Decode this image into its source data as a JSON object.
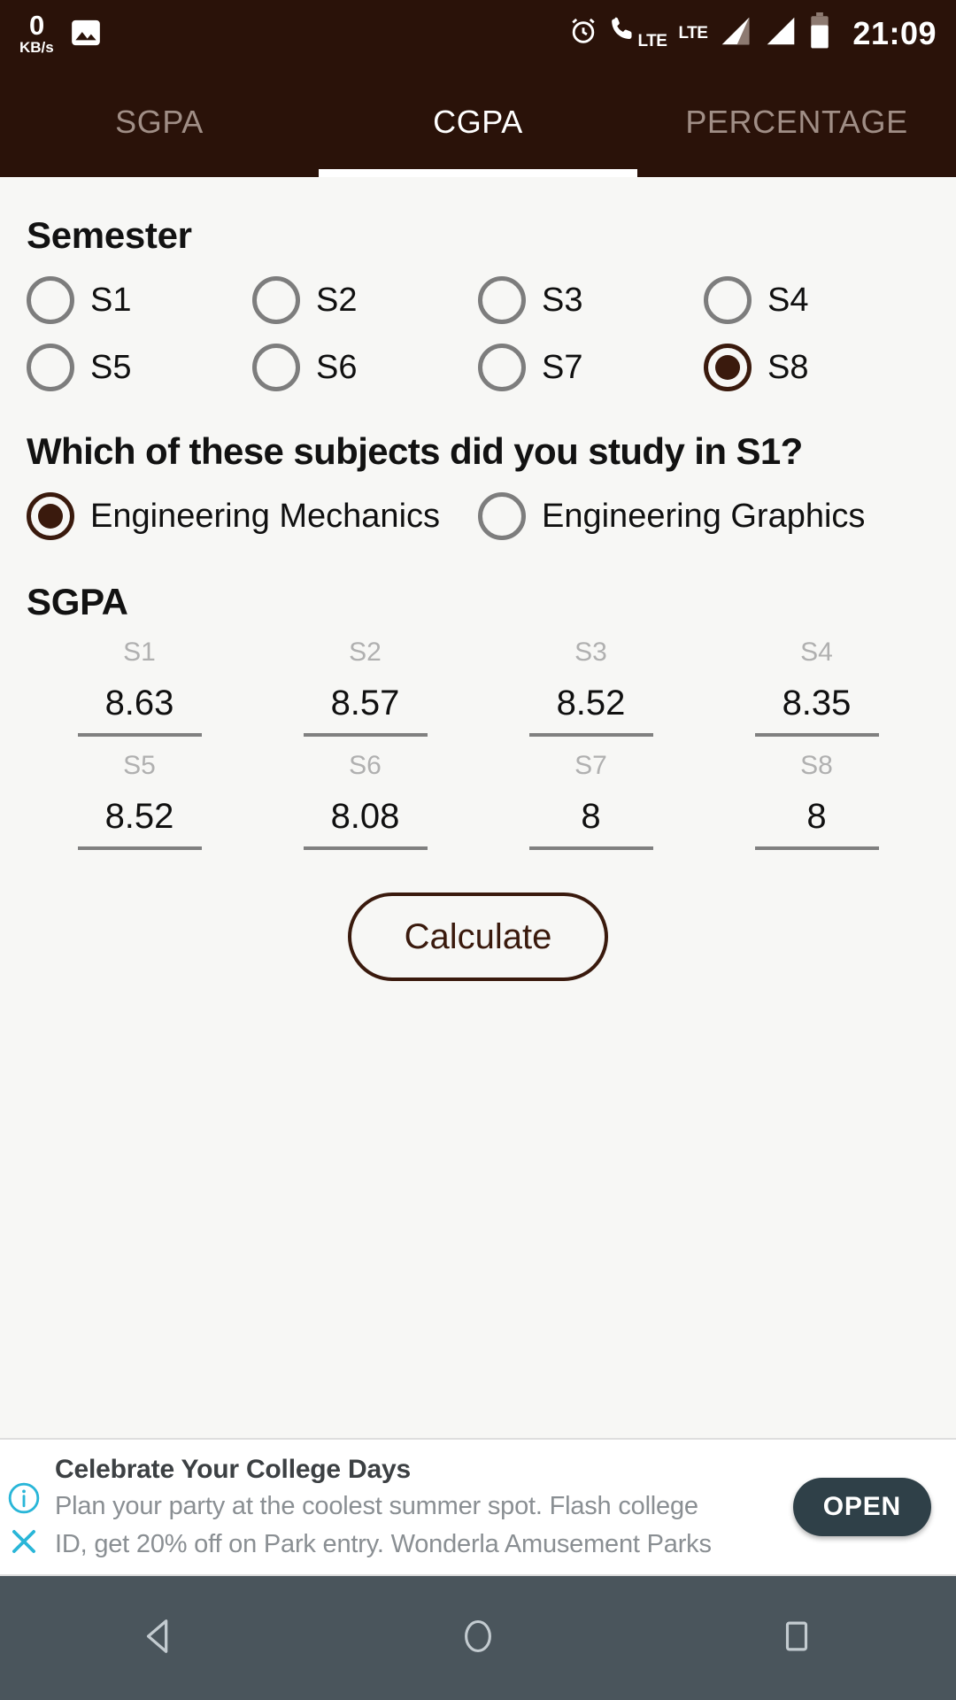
{
  "status_bar": {
    "net_speed_value": "0",
    "net_speed_unit": "KB/s",
    "image_icon": "image-icon",
    "alarm_icon": "alarm-icon",
    "call_icon": "call-icon",
    "lte_label_1": "LTE",
    "lte_label_2": "LTE",
    "signal_icon_1": "signal-bars-icon",
    "signal_icon_2": "signal-bars-icon",
    "battery_icon": "battery-icon",
    "time": "21:09",
    "background": "#2a1209"
  },
  "tabs": {
    "items": [
      {
        "label": "SGPA",
        "active": false
      },
      {
        "label": "CGPA",
        "active": true
      },
      {
        "label": "PERCENTAGE",
        "active": false
      }
    ],
    "active_index": 1,
    "indicator_color": "#ffffff"
  },
  "semester": {
    "title": "Semester",
    "options": [
      {
        "label": "S1",
        "selected": false
      },
      {
        "label": "S2",
        "selected": false
      },
      {
        "label": "S3",
        "selected": false
      },
      {
        "label": "S4",
        "selected": false
      },
      {
        "label": "S5",
        "selected": false
      },
      {
        "label": "S6",
        "selected": false
      },
      {
        "label": "S7",
        "selected": false
      },
      {
        "label": "S8",
        "selected": true
      }
    ],
    "selected_value": "S8"
  },
  "subject_question": {
    "title": "Which of these subjects did you study in S1?",
    "options": [
      {
        "label": "Engineering Mechanics",
        "selected": true
      },
      {
        "label": "Engineering Graphics",
        "selected": false
      }
    ],
    "selected_value": "Engineering Mechanics"
  },
  "sgpa": {
    "title": "SGPA",
    "fields": [
      {
        "label": "S1",
        "value": "8.63"
      },
      {
        "label": "S2",
        "value": "8.57"
      },
      {
        "label": "S3",
        "value": "8.52"
      },
      {
        "label": "S4",
        "value": "8.35"
      },
      {
        "label": "S5",
        "value": "8.52"
      },
      {
        "label": "S6",
        "value": "8.08"
      },
      {
        "label": "S7",
        "value": "8"
      },
      {
        "label": "S8",
        "value": "8"
      }
    ]
  },
  "calculate": {
    "label": "Calculate",
    "accent": "#3a1a0d"
  },
  "ad": {
    "title": "Celebrate Your College Days",
    "description_line_1": "Plan your party at the coolest summer spot. Flash college",
    "description_line_2": "ID, get 20% off on Park entry. Wonderla Amusement Parks",
    "cta_label": "OPEN",
    "info_icon": "info-icon",
    "close_icon": "close-icon",
    "icon_color": "#29b6d8",
    "cta_background": "#2f4048"
  },
  "nav_bar": {
    "back_icon": "back-triangle-icon",
    "home_icon": "home-circle-icon",
    "recents_icon": "recents-square-icon",
    "background": "#4a555c"
  }
}
